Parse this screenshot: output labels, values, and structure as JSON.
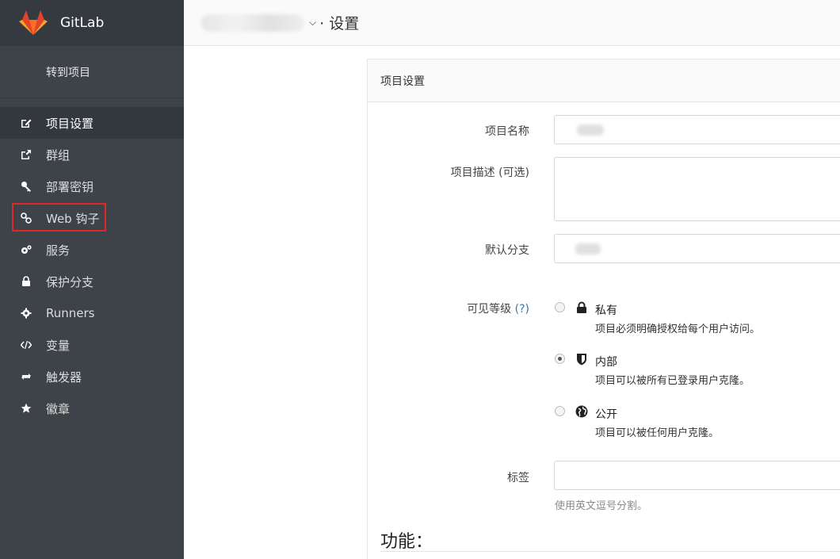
{
  "brand": {
    "name": "GitLab"
  },
  "sidebar": {
    "goto_label": "转到项目",
    "items": [
      {
        "label": "项目设置",
        "icon": "edit-icon",
        "active": true
      },
      {
        "label": "群组",
        "icon": "share-icon"
      },
      {
        "label": "部署密钥",
        "icon": "key-icon"
      },
      {
        "label": "Web 钩子",
        "icon": "link-icon",
        "highlighted": true
      },
      {
        "label": "服务",
        "icon": "cogs-icon"
      },
      {
        "label": "保护分支",
        "icon": "lock-icon"
      },
      {
        "label": "Runners",
        "icon": "gear-icon"
      },
      {
        "label": "变量",
        "icon": "code-icon"
      },
      {
        "label": "触发器",
        "icon": "retweet-icon"
      },
      {
        "label": "徽章",
        "icon": "star-icon"
      }
    ]
  },
  "header": {
    "separator": "·",
    "title": "设置"
  },
  "panel": {
    "title": "项目设置",
    "fields": {
      "name_label": "项目名称",
      "description_label": "项目描述 (可选)",
      "default_branch_label": "默认分支",
      "visibility_label": "可见等级",
      "visibility_help": "(?)",
      "tags_label": "标签",
      "tags_hint": "使用英文逗号分割。"
    },
    "visibility": [
      {
        "title": "私有",
        "desc": "项目必须明确授权给每个用户访问。",
        "icon": "lock-icon",
        "checked": false
      },
      {
        "title": "内部",
        "desc": "项目可以被所有已登录用户克隆。",
        "icon": "shield-icon",
        "checked": true
      },
      {
        "title": "公开",
        "desc": "项目可以被任何用户克隆。",
        "icon": "globe-icon",
        "checked": false
      }
    ],
    "features_title": "功能："
  },
  "colors": {
    "sidebar_bg": "#3d4349",
    "highlight": "#e02828",
    "link": "#3777b0"
  }
}
